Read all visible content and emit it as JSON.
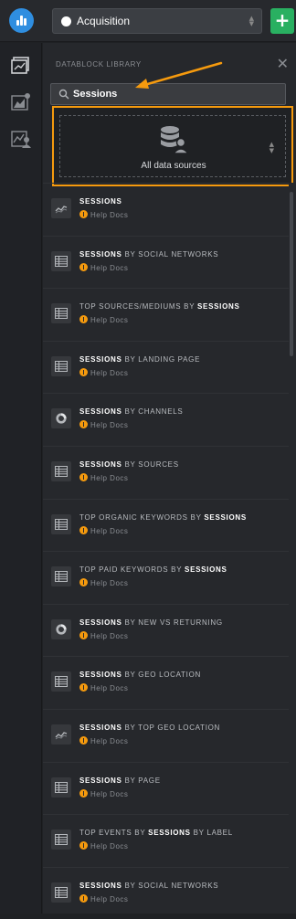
{
  "header": {
    "selector_title": "Acquisition"
  },
  "panel": {
    "title": "DATABLOCK LIBRARY",
    "search_value": "Sessions",
    "source_label": "All data sources"
  },
  "colors": {
    "accent_orange": "#f59a0e",
    "add_green": "#29b061",
    "logo_blue": "#2f8ee0"
  },
  "results": [
    {
      "pre": "",
      "bold": "SESSIONS",
      "post": "",
      "help": "Help Docs",
      "icon": "line-chart-icon"
    },
    {
      "pre": "",
      "bold": "SESSIONS",
      "post": " BY SOCIAL NETWORKS",
      "help": "Help Docs",
      "icon": "table-icon"
    },
    {
      "pre": "TOP SOURCES/MEDIUMS BY ",
      "bold": "SESSIONS",
      "post": "",
      "help": "Help Docs",
      "icon": "table-icon"
    },
    {
      "pre": "",
      "bold": "SESSIONS",
      "post": " BY LANDING PAGE",
      "help": "Help Docs",
      "icon": "table-icon"
    },
    {
      "pre": "",
      "bold": "SESSIONS",
      "post": " BY CHANNELS",
      "help": "Help Docs",
      "icon": "donut-icon"
    },
    {
      "pre": "",
      "bold": "SESSIONS",
      "post": " BY SOURCES",
      "help": "Help Docs",
      "icon": "table-icon"
    },
    {
      "pre": "TOP ORGANIC KEYWORDS BY ",
      "bold": "SESSIONS",
      "post": "",
      "help": "Help Docs",
      "icon": "table-icon"
    },
    {
      "pre": "TOP PAID KEYWORDS BY ",
      "bold": "SESSIONS",
      "post": "",
      "help": "Help Docs",
      "icon": "table-icon"
    },
    {
      "pre": "",
      "bold": "SESSIONS",
      "post": " BY NEW VS RETURNING",
      "help": "Help Docs",
      "icon": "donut-icon"
    },
    {
      "pre": "",
      "bold": "SESSIONS",
      "post": " BY GEO LOCATION",
      "help": "Help Docs",
      "icon": "table-icon"
    },
    {
      "pre": "",
      "bold": "SESSIONS",
      "post": " BY TOP GEO LOCATION",
      "help": "Help Docs",
      "icon": "line-chart-icon"
    },
    {
      "pre": "",
      "bold": "SESSIONS",
      "post": " BY PAGE",
      "help": "Help Docs",
      "icon": "table-icon"
    },
    {
      "pre": "TOP EVENTS BY ",
      "bold": "SESSIONS",
      "post": " BY LABEL",
      "help": "Help Docs",
      "icon": "table-icon"
    },
    {
      "pre": "",
      "bold": "SESSIONS",
      "post": " BY SOCIAL NETWORKS",
      "help": "Help Docs",
      "icon": "table-icon"
    }
  ]
}
